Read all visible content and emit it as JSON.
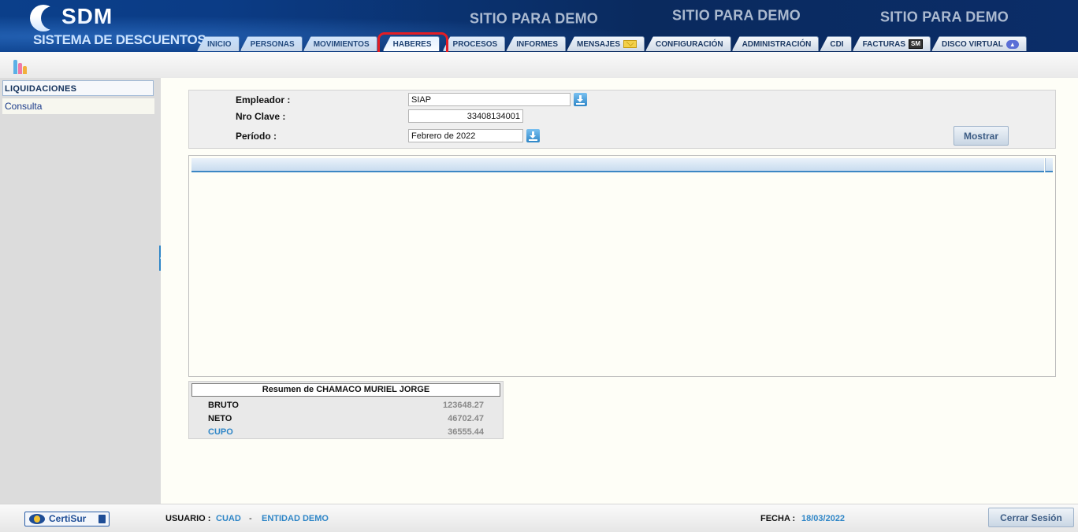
{
  "header": {
    "logo_title": "SDM",
    "logo_subtitle": "SISTEMA DE DESCUENTOS",
    "demo_banner": "SITIO PARA DEMO",
    "tabs": [
      {
        "label": "INICIO"
      },
      {
        "label": "PERSONAS"
      },
      {
        "label": "MOVIMIENTOS"
      },
      {
        "label": "HABERES",
        "active": true
      },
      {
        "label": "PROCESOS"
      },
      {
        "label": "INFORMES"
      },
      {
        "label": "MENSAJES",
        "icon": "mail-icon"
      },
      {
        "label": "CONFIGURACIÓN"
      },
      {
        "label": "ADMINISTRACIÓN"
      },
      {
        "label": "CDI"
      },
      {
        "label": "FACTURAS",
        "icon": "sm-icon"
      },
      {
        "label": "DISCO VIRTUAL",
        "icon": "cloud-upload-icon"
      }
    ],
    "sm_icon_text": "SM",
    "highlight_color": "#e41d24"
  },
  "sidebar": {
    "section_title": "LIQUIDACIONES",
    "items": [
      {
        "label": "Consulta"
      }
    ]
  },
  "form": {
    "empleador_label": "Empleador :",
    "empleador_value": "SIAP",
    "nro_clave_label": "Nro Clave :",
    "nro_clave_value": "33408134001",
    "periodo_label": "Período :",
    "periodo_value": "Febrero de 2022",
    "mostrar_button": "Mostrar"
  },
  "summary": {
    "title": "Resumen de CHAMACO MURIEL JORGE",
    "rows": [
      {
        "label": "BRUTO",
        "value": "123648.27"
      },
      {
        "label": "NETO",
        "value": "46702.47"
      },
      {
        "label": "CUPO",
        "value": "36555.44"
      }
    ]
  },
  "footer": {
    "certisur": "CertiSur",
    "usuario_label": "USUARIO :",
    "usuario_value": "CUAD",
    "separator": "-",
    "entidad_value": "ENTIDAD DEMO",
    "fecha_label": "FECHA :",
    "fecha_value": "18/03/2022",
    "cerrar_button": "Cerrar Sesión"
  },
  "colors": {
    "header_bg": "#0b3f8a",
    "accent_blue": "#2f86c7",
    "main_bg": "#fefef7"
  }
}
